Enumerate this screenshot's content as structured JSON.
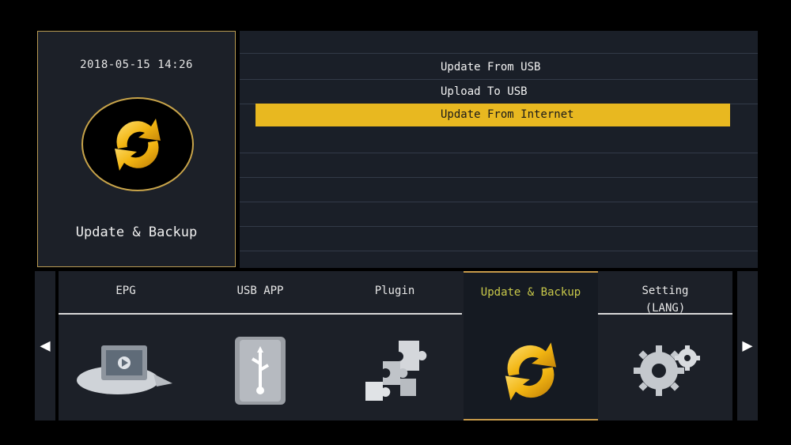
{
  "info": {
    "clock": "2018-05-15 14:26",
    "title": "Update & Backup",
    "icon": "update-backup-icon"
  },
  "menu": {
    "items": [
      {
        "label": "Update From USB"
      },
      {
        "label": "Upload To USB"
      },
      {
        "label": "Update From Internet"
      }
    ],
    "selected_index": 2
  },
  "tabs": {
    "items": [
      {
        "label": "EPG",
        "icon": "epg-tv-icon"
      },
      {
        "label": "USB APP",
        "icon": "usb-drive-icon"
      },
      {
        "label": "Plugin",
        "icon": "puzzle-icon"
      },
      {
        "label": "Update & Backup",
        "icon": "update-backup-icon"
      },
      {
        "label": "Setting\n(LANG)",
        "icon": "gear-icon"
      }
    ],
    "active_index": 3
  },
  "nav": {
    "left_arrow": "◀",
    "right_arrow": "▶"
  },
  "colors": {
    "accent": "#e8b820",
    "panel": "#1c2028",
    "active_tab_label": "#c9c94a",
    "border": "#b89a52"
  }
}
